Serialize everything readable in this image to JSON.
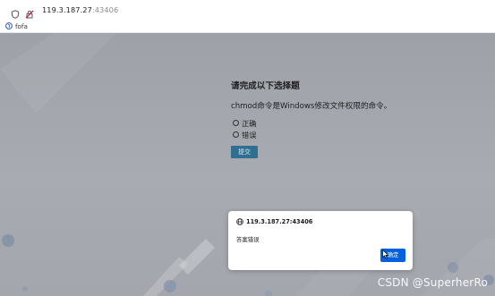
{
  "browser": {
    "url_host": "119.3.187.27",
    "url_port": ":43406"
  },
  "bookmarks": [
    {
      "label": "fofa"
    }
  ],
  "quiz": {
    "title": "请完成以下选择题",
    "question": "chmod命令是Windows修改文件权限的命令。",
    "options": [
      "正确",
      "错误"
    ],
    "submit_label": "提交"
  },
  "dialog": {
    "origin": "119.3.187.27:43406",
    "message": "答案错误",
    "ok_label": "确定"
  },
  "watermark": "CSDN @SuperherRo"
}
